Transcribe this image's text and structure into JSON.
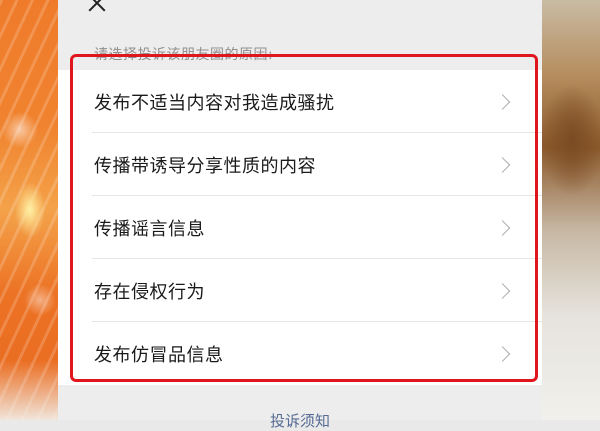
{
  "prompt": "请选择投诉该朋友圈的原因:",
  "reasons": [
    {
      "label": "发布不适当内容对我造成骚扰"
    },
    {
      "label": "传播带诱导分享性质的内容"
    },
    {
      "label": "传播谣言信息"
    },
    {
      "label": "存在侵权行为"
    },
    {
      "label": "发布仿冒品信息"
    }
  ],
  "footer": {
    "notice_link": "投诉须知"
  },
  "icons": {
    "close": "close-icon",
    "row": "chevron-right-icon"
  },
  "colors": {
    "highlight": "#e0161e",
    "link": "#576b95"
  }
}
